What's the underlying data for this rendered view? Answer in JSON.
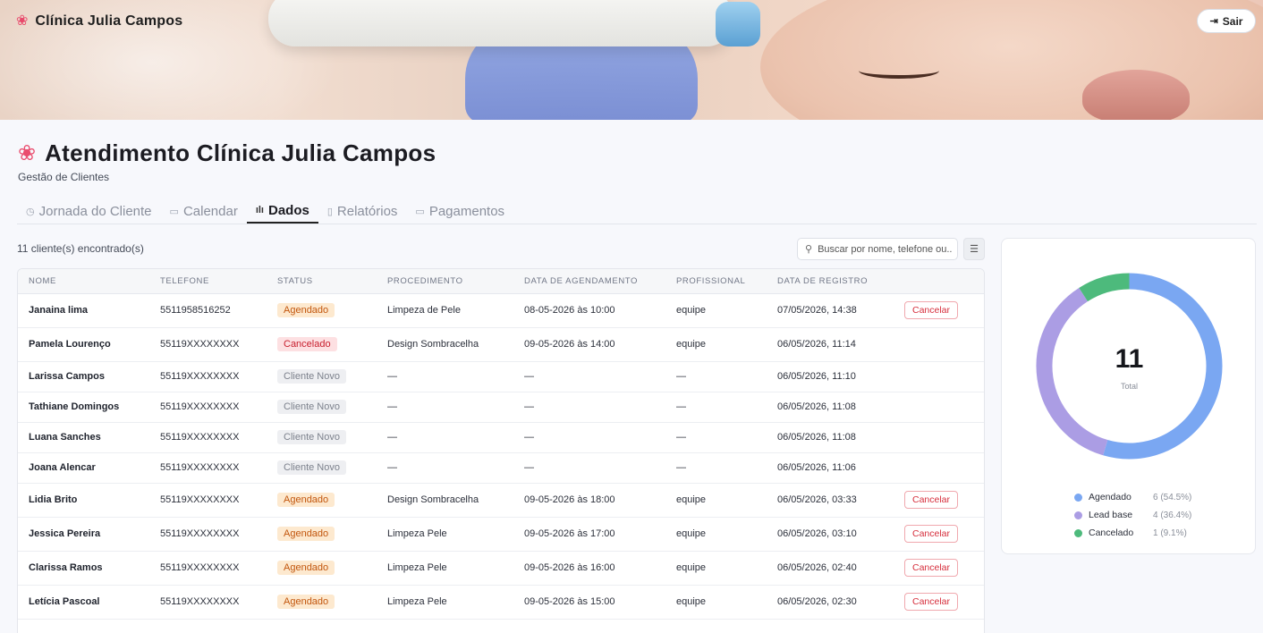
{
  "header": {
    "brand": "Clínica Julia Campos",
    "logout_label": "Sair"
  },
  "page": {
    "title": "Atendimento Clínica Julia Campos",
    "subtitle": "Gestão de Clientes"
  },
  "tabs": [
    {
      "label": "Jornada do Cliente",
      "icon": "clock-icon"
    },
    {
      "label": "Calendar",
      "icon": "calendar-icon"
    },
    {
      "label": "Dados",
      "icon": "bar-chart-icon",
      "active": true
    },
    {
      "label": "Relatórios",
      "icon": "document-icon"
    },
    {
      "label": "Pagamentos",
      "icon": "credit-card-icon"
    }
  ],
  "toolbar": {
    "count_text": "11 cliente(s) encontrado(s)",
    "search_placeholder": "Buscar por nome, telefone ou..."
  },
  "table": {
    "columns": [
      "NOME",
      "TELEFONE",
      "STATUS",
      "PROCEDIMENTO",
      "DATA DE AGENDAMENTO",
      "PROFISSIONAL",
      "DATA DE REGISTRO"
    ],
    "cancel_label": "Cancelar",
    "rows": [
      {
        "nome": "Janaina lima",
        "telefone": "5511958516252",
        "status": "Agendado",
        "status_type": "agendado",
        "procedimento": "Limpeza de Pele",
        "agendamento": "08-05-2026 às 10:00",
        "profissional": "equipe",
        "registro": "07/05/2026, 14:38",
        "cancel": true
      },
      {
        "nome": "Pamela Lourenço",
        "telefone": "55119XXXXXXXX",
        "status": "Cancelado",
        "status_type": "cancelado",
        "procedimento": "Design Sombracelha",
        "agendamento": "09-05-2026 às 14:00",
        "profissional": "equipe",
        "registro": "06/05/2026, 11:14",
        "cancel": false
      },
      {
        "nome": "Larissa Campos",
        "telefone": "55119XXXXXXXX",
        "status": "Cliente Novo",
        "status_type": "novo",
        "procedimento": "—",
        "agendamento": "—",
        "profissional": "—",
        "registro": "06/05/2026, 11:10",
        "cancel": false
      },
      {
        "nome": "Tathiane Domingos",
        "telefone": "55119XXXXXXXX",
        "status": "Cliente Novo",
        "status_type": "novo",
        "procedimento": "—",
        "agendamento": "—",
        "profissional": "—",
        "registro": "06/05/2026, 11:08",
        "cancel": false
      },
      {
        "nome": "Luana Sanches",
        "telefone": "55119XXXXXXXX",
        "status": "Cliente Novo",
        "status_type": "novo",
        "procedimento": "—",
        "agendamento": "—",
        "profissional": "—",
        "registro": "06/05/2026, 11:08",
        "cancel": false
      },
      {
        "nome": "Joana Alencar",
        "telefone": "55119XXXXXXXX",
        "status": "Cliente Novo",
        "status_type": "novo",
        "procedimento": "—",
        "agendamento": "—",
        "profissional": "—",
        "registro": "06/05/2026, 11:06",
        "cancel": false
      },
      {
        "nome": "Lidia Brito",
        "telefone": "55119XXXXXXXX",
        "status": "Agendado",
        "status_type": "agendado",
        "procedimento": "Design Sombracelha",
        "agendamento": "09-05-2026 às 18:00",
        "profissional": "equipe",
        "registro": "06/05/2026, 03:33",
        "cancel": true
      },
      {
        "nome": "Jessica Pereira",
        "telefone": "55119XXXXXXXX",
        "status": "Agendado",
        "status_type": "agendado",
        "procedimento": "Limpeza Pele",
        "agendamento": "09-05-2026 às 17:00",
        "profissional": "equipe",
        "registro": "06/05/2026, 03:10",
        "cancel": true
      },
      {
        "nome": "Clarissa Ramos",
        "telefone": "55119XXXXXXXX",
        "status": "Agendado",
        "status_type": "agendado",
        "procedimento": "Limpeza Pele",
        "agendamento": "09-05-2026 às 16:00",
        "profissional": "equipe",
        "registro": "06/05/2026, 02:40",
        "cancel": true
      },
      {
        "nome": "Letícia Pascoal",
        "telefone": "55119XXXXXXXX",
        "status": "Agendado",
        "status_type": "agendado",
        "procedimento": "Limpeza Pele",
        "agendamento": "09-05-2026 às 15:00",
        "profissional": "equipe",
        "registro": "06/05/2026, 02:30",
        "cancel": true
      }
    ]
  },
  "summary": {
    "total": "11",
    "total_label": "Total",
    "colors": {
      "agendado": "#7aa7f2",
      "lead_base": "#ab9de4",
      "cancelado": "#4dba7c"
    },
    "legend": [
      {
        "label": "Agendado",
        "value": "6 (54.5%)",
        "color": "#7aa7f2"
      },
      {
        "label": "Lead base",
        "value": "4 (36.4%)",
        "color": "#ab9de4"
      },
      {
        "label": "Cancelado",
        "value": "1 (9.1%)",
        "color": "#4dba7c"
      }
    ]
  },
  "chart_data": {
    "type": "pie",
    "categories": [
      "Agendado",
      "Lead base",
      "Cancelado"
    ],
    "values": [
      6,
      4,
      1
    ],
    "title": "",
    "xlabel": "",
    "ylabel": ""
  }
}
